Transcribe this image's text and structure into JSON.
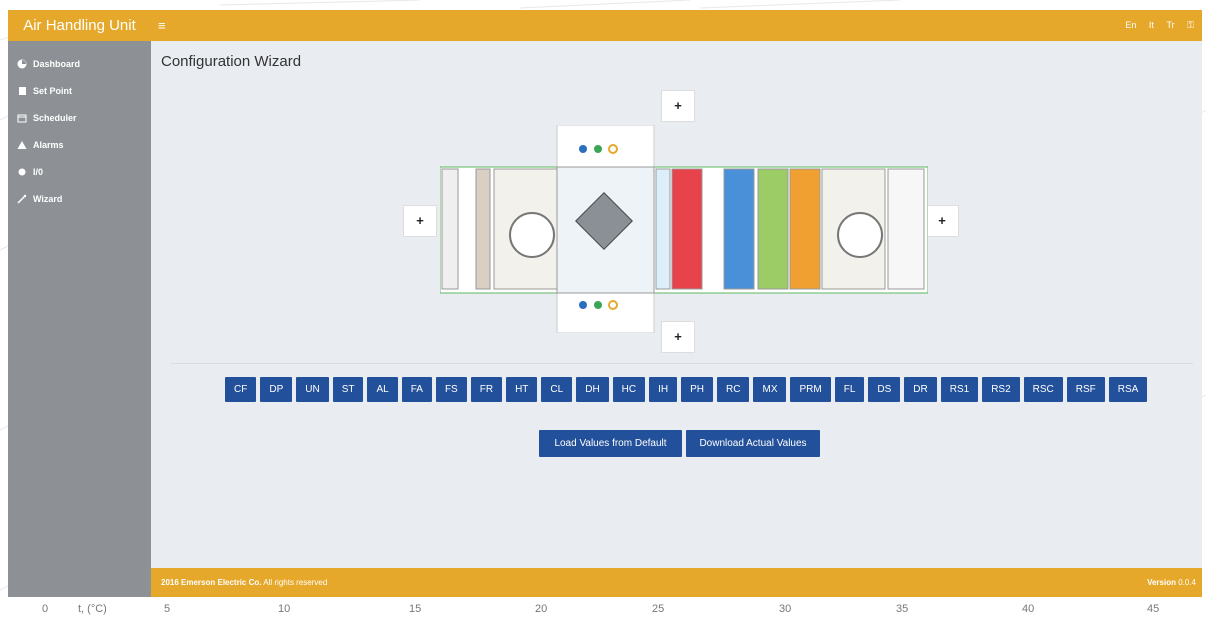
{
  "header": {
    "brand": "Air Handling Unit",
    "menu_icon": "bars-icon",
    "languages": [
      "En",
      "It",
      "Tr"
    ],
    "settings_icon": "key-icon"
  },
  "sidebar": {
    "items": [
      {
        "label": "Dashboard",
        "icon": "dashboard-icon"
      },
      {
        "label": "Set Point",
        "icon": "book-icon"
      },
      {
        "label": "Scheduler",
        "icon": "calendar-icon"
      },
      {
        "label": "Alarms",
        "icon": "warning-icon"
      },
      {
        "label": "I/0",
        "icon": "circle-icon"
      },
      {
        "label": "Wizard",
        "icon": "wand-icon"
      }
    ]
  },
  "main": {
    "title": "Configuration Wizard",
    "component_buttons": [
      "CF",
      "DP",
      "UN",
      "ST",
      "AL",
      "FA",
      "FS",
      "FR",
      "HT",
      "CL",
      "DH",
      "HC",
      "IH",
      "PH",
      "RC",
      "MX",
      "PRM",
      "FL",
      "DS",
      "DR",
      "RS1",
      "RS2",
      "RSC",
      "RSF",
      "RSA"
    ],
    "load_default": "Load Values from Default",
    "download_actual": "Download Actual Values",
    "plus_label": "+"
  },
  "footer": {
    "copyright_bold": "2016 Emerson Electric Co.",
    "copyright_rest": " All rights reserved",
    "version_label": "Version",
    "version_value": "0.0.4"
  },
  "background": {
    "tick_labels": [
      "0",
      "t, (°C)",
      "5",
      "10",
      "15",
      "20",
      "25",
      "30",
      "35",
      "40",
      "45"
    ]
  },
  "colors": {
    "accent": "#e6a82a",
    "sidebar": "#8d9196",
    "button": "#23509a",
    "main_bg": "#e9edf2"
  }
}
